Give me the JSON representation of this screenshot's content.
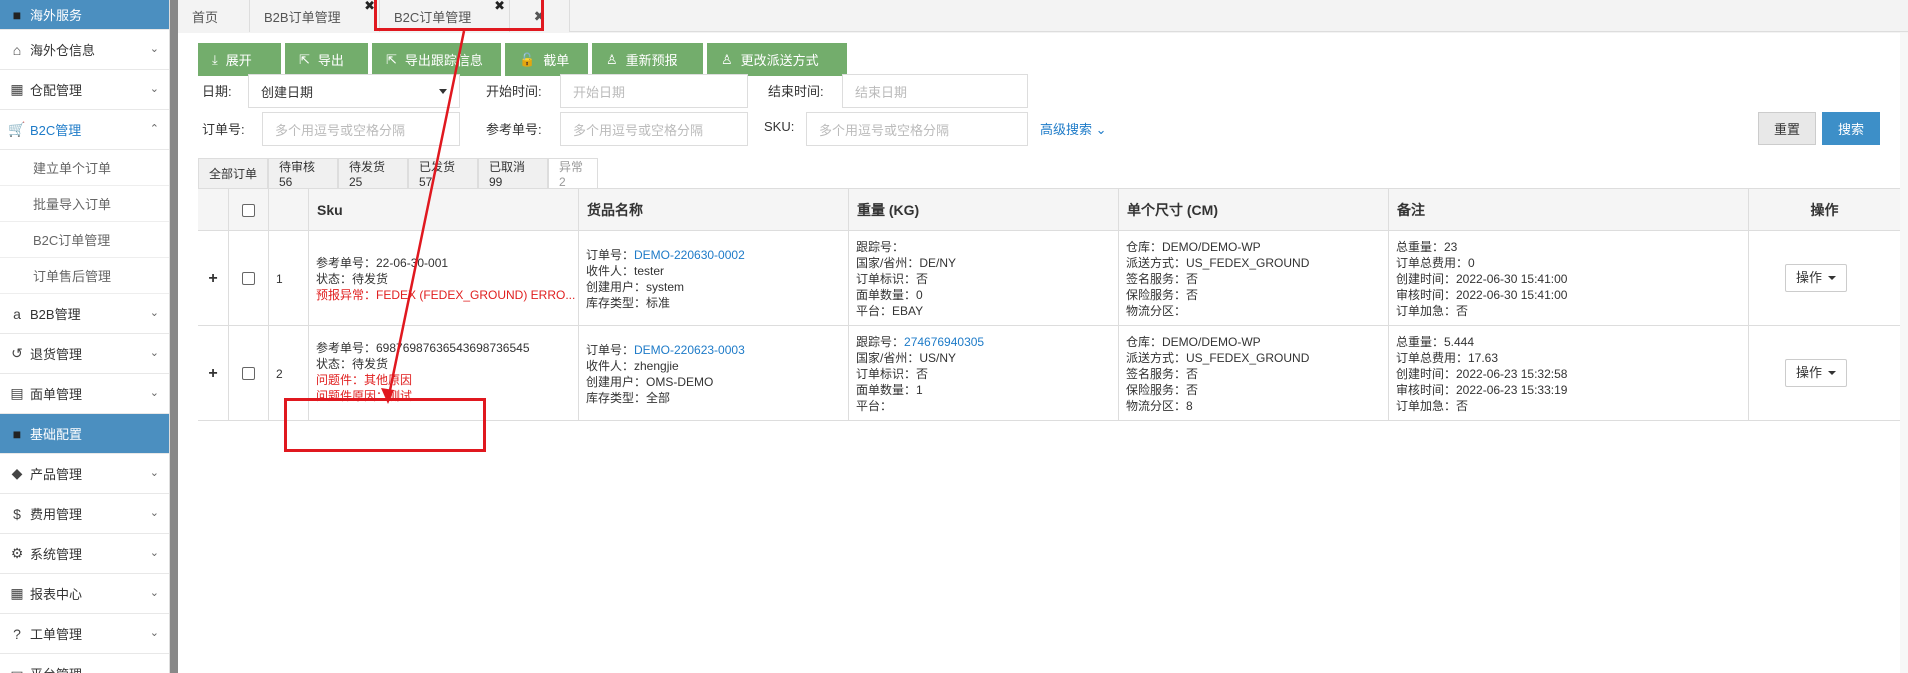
{
  "sidebar": {
    "items": [
      {
        "label": "海外服务",
        "icon": "folder-icon",
        "style": "dark"
      },
      {
        "label": "海外仓信息",
        "icon": "home-icon"
      },
      {
        "label": "仓配管理",
        "icon": "grid-icon"
      },
      {
        "label": "B2C管理",
        "icon": "cart-icon",
        "active": true
      },
      {
        "label": "建立单个订单",
        "sub": true
      },
      {
        "label": "批量导入订单",
        "sub": true
      },
      {
        "label": "B2C订单管理",
        "sub": true
      },
      {
        "label": "订单售后管理",
        "sub": true
      },
      {
        "label": "B2B管理",
        "icon": "amazon-icon"
      },
      {
        "label": "退货管理",
        "icon": "undo-icon"
      },
      {
        "label": "面单管理",
        "icon": "document-icon"
      },
      {
        "label": "基础配置",
        "icon": "folder-icon",
        "style": "dark"
      },
      {
        "label": "产品管理",
        "icon": "tag-icon"
      },
      {
        "label": "费用管理",
        "icon": "dollar-icon"
      },
      {
        "label": "系统管理",
        "icon": "gear-icon"
      },
      {
        "label": "报表中心",
        "icon": "table-icon"
      },
      {
        "label": "工单管理",
        "icon": "question-icon"
      },
      {
        "label": "平台管理",
        "icon": "folder-icon"
      }
    ]
  },
  "tabs": [
    {
      "label": "首页"
    },
    {
      "label": "B2B订单管理",
      "close": "✖"
    },
    {
      "label": "B2C订单管理",
      "close": "✖"
    },
    {
      "label": "",
      "close": "✖"
    }
  ],
  "toolbar": [
    {
      "label": "展开",
      "icon": "download-icon"
    },
    {
      "label": "导出",
      "icon": "export-icon"
    },
    {
      "label": "导出跟踪信息",
      "icon": "export-icon"
    },
    {
      "label": "截单",
      "icon": "lock-icon"
    },
    {
      "label": "重新预报",
      "icon": "user-icon"
    },
    {
      "label": "更改派送方式",
      "icon": "user-icon"
    }
  ],
  "filters": {
    "date_label": "日期:",
    "date_value": "创建日期",
    "start_label": "开始时间:",
    "start_placeholder": "开始日期",
    "end_label": "结束时间:",
    "end_placeholder": "结束日期",
    "order_label": "订单号:",
    "order_placeholder": "多个用逗号或空格分隔",
    "ref_label": "参考单号:",
    "ref_placeholder": "多个用逗号或空格分隔",
    "sku_label": "SKU:",
    "sku_placeholder": "多个用逗号或空格分隔",
    "advanced": "高级搜索",
    "reset": "重置",
    "search": "搜索"
  },
  "status_tabs": [
    "全部订单",
    "待审核56",
    "待发货25",
    "已发货57",
    "已取消99",
    "异常2"
  ],
  "table": {
    "headers": [
      "Sku",
      "货品名称",
      "重量 (KG)",
      "单个尺寸 (CM)",
      "备注",
      "操作"
    ],
    "rows": [
      {
        "index": "1",
        "sku": [
          "参考单号：22-06-30-001",
          "状态：待发货"
        ],
        "sku_error": "预报异常：FEDEX (FEDEX_GROUND) ERRO...",
        "order_label": "订单号：",
        "order_no": "DEMO-220630-0002",
        "goods": [
          "收件人：tester",
          "创建用户：system",
          "库存类型：标准"
        ],
        "track_label": "跟踪号：",
        "track_no": "",
        "weight": [
          "国家/省州：DE/NY",
          "订单标识：否",
          "面单数量：0",
          "平台：EBAY"
        ],
        "size": [
          "仓库：DEMO/DEMO-WP",
          "派送方式：US_FEDEX_GROUND",
          "签名服务：否",
          "保险服务：否",
          "物流分区："
        ],
        "remark": [
          "总重量：23",
          "订单总费用：0",
          "创建时间：2022-06-30 15:41:00",
          "审核时间：2022-06-30 15:41:00",
          "订单加急：否"
        ],
        "op": "操作"
      },
      {
        "index": "2",
        "sku": [
          "参考单号：69876987636543698736545",
          "状态：待发货"
        ],
        "sku_errors": [
          "问题件：其他原因",
          "问题件原因：测试"
        ],
        "order_label": "订单号：",
        "order_no": "DEMO-220623-0003",
        "goods": [
          "收件人：zhengjie",
          "创建用户：OMS-DEMO",
          "库存类型：全部"
        ],
        "track_label": "跟踪号：",
        "track_no": "274676940305",
        "weight": [
          "国家/省州：US/NY",
          "订单标识：否",
          "面单数量：1",
          "平台："
        ],
        "size": [
          "仓库：DEMO/DEMO-WP",
          "派送方式：US_FEDEX_GROUND",
          "签名服务：否",
          "保险服务：否",
          "物流分区：8"
        ],
        "remark": [
          "总重量：5.444",
          "订单总费用：17.63",
          "创建时间：2022-06-23 15:32:58",
          "审核时间：2022-06-23 15:33:19",
          "订单加急：否"
        ],
        "op": "操作"
      }
    ]
  },
  "colors": {
    "green": "#73ad6c",
    "blue": "#3d8fc8",
    "highlight": "#e0181f",
    "link": "#1e7bc8"
  }
}
